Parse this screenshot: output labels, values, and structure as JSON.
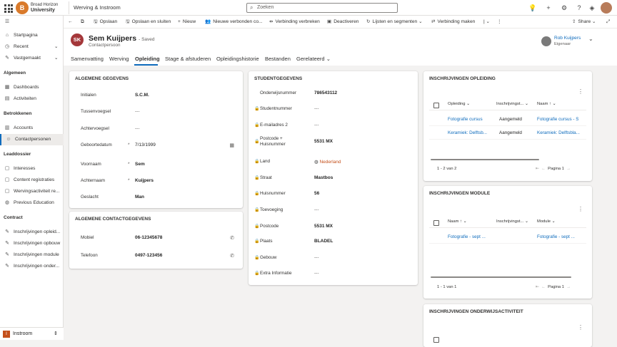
{
  "topbar": {
    "org_line1": "Broad Horizon",
    "org_line2": "University",
    "app_name": "Werving & Instroom",
    "search_placeholder": "Zoeken",
    "icons": [
      "lightbulb-icon",
      "plus-icon",
      "gear-icon",
      "help-icon",
      "copilot-icon"
    ]
  },
  "sidebar": {
    "top": [
      {
        "label": "Startpagina",
        "icon": "home-icon"
      },
      {
        "label": "Recent",
        "icon": "clock-icon",
        "chevron": true
      },
      {
        "label": "Vastgemaakt",
        "icon": "pin-icon",
        "chevron": true
      }
    ],
    "groups": [
      {
        "title": "Algemeen",
        "items": [
          {
            "label": "Dashboards",
            "icon": "dashboard-icon"
          },
          {
            "label": "Activiteiten",
            "icon": "activity-icon"
          }
        ]
      },
      {
        "title": "Betrokkenen",
        "items": [
          {
            "label": "Accounts",
            "icon": "building-icon"
          },
          {
            "label": "Contactpersonen",
            "icon": "person-icon",
            "active": true
          }
        ]
      },
      {
        "title": "Leaddossier",
        "items": [
          {
            "label": "Interesses",
            "icon": "doc-icon"
          },
          {
            "label": "Content registraties",
            "icon": "doc-icon"
          },
          {
            "label": "Wervingsactiviteit re...",
            "icon": "doc-icon"
          },
          {
            "label": "Previous Education",
            "icon": "globe-icon"
          }
        ]
      },
      {
        "title": "Contract",
        "items": [
          {
            "label": "Inschrijvingen opleid...",
            "icon": "edit-icon"
          },
          {
            "label": "Inschrijvingen opbouw",
            "icon": "edit-icon"
          },
          {
            "label": "Inschrijvingen module",
            "icon": "edit-icon"
          },
          {
            "label": "Inschrijvingen onder...",
            "icon": "edit-icon"
          }
        ]
      }
    ],
    "area": {
      "badge": "I",
      "label": "Instroom"
    }
  },
  "commands": [
    "Opslaan",
    "Opslaan en sluiten",
    "Nieuw",
    "Nieuwe verbonden co...",
    "Verbinding verbreken",
    "Deactiveren",
    "Lijsten en segmenten",
    "Verbinding maken"
  ],
  "share_label": "Share",
  "record": {
    "initials": "SK",
    "name": "Sem Kuijpers",
    "saved": "- Saved",
    "type": "Contactpersoon",
    "owner_name": "Rob Kuijpers",
    "owner_label": "Eigenaar"
  },
  "tabs": [
    "Samenvatting",
    "Werving",
    "Opleiding",
    "Stage & afstuderen",
    "Opleidingshistorie",
    "Bestanden",
    "Gerelateerd"
  ],
  "general": {
    "title": "ALGEMENE GEGEVENS",
    "fields": [
      {
        "label": "Initialen",
        "value": "S.C.M."
      },
      {
        "label": "Tussenvoegsel",
        "value": "---"
      },
      {
        "label": "Achtervoegsel",
        "value": "---"
      },
      {
        "label": "Geboortedatum",
        "value": "7/13/1999",
        "required": "*"
      },
      {
        "label": "Voornaam",
        "value": "Sem",
        "required": "*"
      },
      {
        "label": "Achternaam",
        "value": "Kuijpers",
        "required": "*"
      },
      {
        "label": "Geslacht",
        "value": "Man"
      }
    ]
  },
  "contact": {
    "title": "ALGEMENE CONTACTGEGEVENS",
    "fields": [
      {
        "label": "Mobiel",
        "value": "06-12345678"
      },
      {
        "label": "Telefoon",
        "value": "0497-123456"
      }
    ]
  },
  "student": {
    "title": "STUDENTGEGEVENS",
    "fields": [
      {
        "label": "Onderwijsnummer",
        "value": "786543112"
      },
      {
        "label": "Studentnummer",
        "value": "---",
        "locked": true
      },
      {
        "label": "E-mailadres 2",
        "value": "---",
        "locked": true
      },
      {
        "label": "Postcode + Huisnummer",
        "value": "5531 MX",
        "locked": true
      },
      {
        "label": "Land",
        "value": "Nederland",
        "locked": true
      },
      {
        "label": "Straat",
        "value": "Mastbos",
        "locked": true
      },
      {
        "label": "Huisnummer",
        "value": "56",
        "locked": true
      },
      {
        "label": "Toevoeging",
        "value": "---",
        "locked": true
      },
      {
        "label": "Postcode",
        "value": "5531 MX",
        "locked": true
      },
      {
        "label": "Plaats",
        "value": "BLADEL",
        "locked": true
      },
      {
        "label": "Gebouw",
        "value": "---",
        "locked": true
      },
      {
        "label": "Extra Informatie",
        "value": "---",
        "locked": true
      }
    ]
  },
  "ins_opleiding": {
    "title": "INSCHRIJVINGEN OPLEIDING",
    "headers": [
      "Opleiding",
      "Inschrijvingst...",
      "Naam"
    ],
    "rows": [
      [
        "Fotografie cursus",
        "Aangemeld",
        "Fotografie cursus - S"
      ],
      [
        "Keramiek: Delftsb...",
        "Aangemeld",
        "Keramiek: Delftsbla..."
      ]
    ],
    "count": "1 - 2 van 2",
    "page": "Pagina 1"
  },
  "ins_module": {
    "title": "INSCHRIJVINGEN MODULE",
    "headers": [
      "Naam",
      "Inschrijvingst...",
      "Module"
    ],
    "rows": [
      [
        "Fotografie - sept ...",
        "",
        "Fotografie - sept ..."
      ]
    ],
    "count": "1 - 1 van 1",
    "page": "Pagina 1"
  },
  "ins_onderwijs": {
    "title": "INSCHRIJVINGEN ONDERWIJSACTIVITEIT"
  }
}
